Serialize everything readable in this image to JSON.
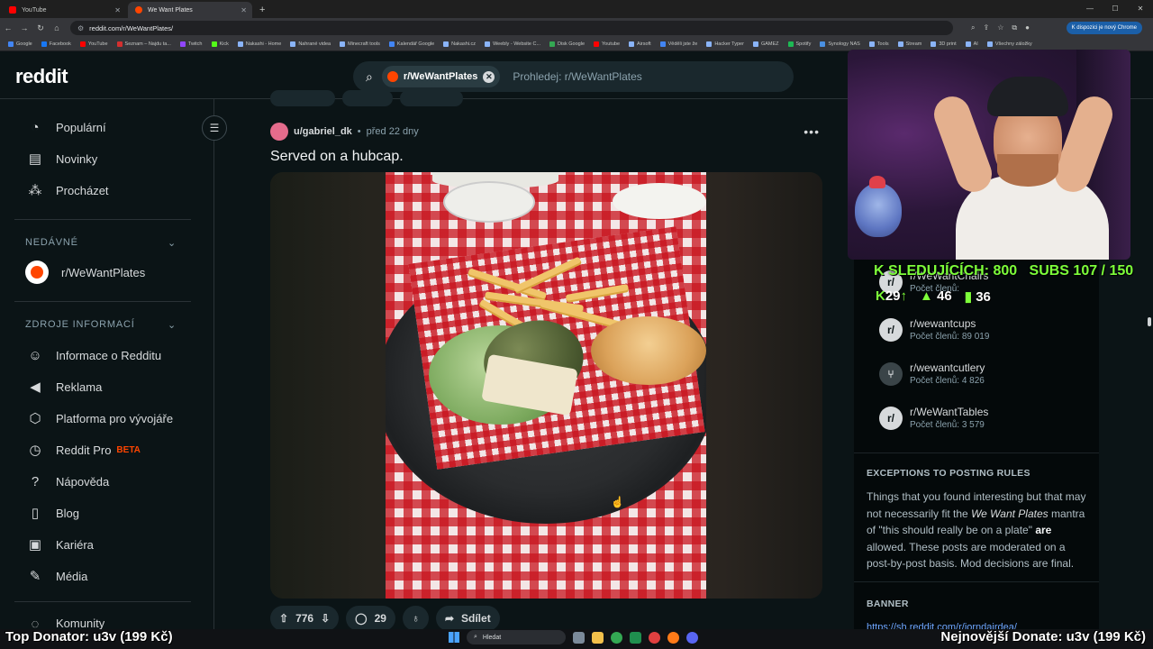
{
  "browser": {
    "tabs": [
      {
        "label": "YouTube",
        "active": false
      },
      {
        "label": "We Want Plates",
        "active": true
      }
    ],
    "new_tab": "+",
    "url": "reddit.com/r/WeWantPlates/",
    "chrome_badge": "K dispozici je nový Chrome",
    "bookmarks": [
      "Google",
      "Facebook",
      "YouTube",
      "Seznam – Najdu ta...",
      "Twitch",
      "Kick",
      "Nakashi - Home",
      "Nahrané videa",
      "Minecraft tools",
      "Kalendář Google",
      "Nakashi.cz",
      "Weebly - Website C...",
      "Disk Google",
      "Youtube",
      "Airsoft",
      "Věděli jste že",
      "Hacker Typer",
      "GAMEZ",
      "Spotify",
      "Synology NAS",
      "Tools",
      "Stream",
      "3D print",
      "AI",
      "Všechny záložky"
    ]
  },
  "reddit": {
    "logo": "reddit",
    "search": {
      "chip_label": "r/WeWantPlates",
      "placeholder": "Prohledej: r/WeWantPlates"
    },
    "nav": {
      "main": [
        {
          "label": "Populární",
          "icon": "trending-icon"
        },
        {
          "label": "Novinky",
          "icon": "news-icon"
        },
        {
          "label": "Procházet",
          "icon": "explore-icon"
        }
      ],
      "recent_title": "NEDÁVNÉ",
      "recent": [
        {
          "label": "r/WeWantPlates"
        }
      ],
      "resources_title": "ZDROJE INFORMACÍ",
      "resources": [
        {
          "label": "Informace o Redditu",
          "icon": "reddit-icon"
        },
        {
          "label": "Reklama",
          "icon": "megaphone-icon"
        },
        {
          "label": "Platforma pro vývojáře",
          "icon": "hexagon-icon"
        },
        {
          "label": "Reddit Pro",
          "icon": "clock-icon",
          "badge": "BETA"
        },
        {
          "label": "Nápověda",
          "icon": "help-icon"
        },
        {
          "label": "Blog",
          "icon": "book-icon"
        },
        {
          "label": "Kariéra",
          "icon": "briefcase-icon"
        },
        {
          "label": "Média",
          "icon": "mic-icon"
        }
      ],
      "communities_cut": "Komunity"
    },
    "post": {
      "author": "u/gabriel_dk",
      "separator": "•",
      "age": "před 22 dny",
      "more": "•••",
      "title": "Served on a hubcap.",
      "votes": "776",
      "comments": "29",
      "share": "Sdílet"
    },
    "sidebar": {
      "related": [
        {
          "name": "r/WeWantChairs",
          "meta": "Počet členů:"
        },
        {
          "name": "r/wewantcups",
          "meta": "Počet členů: 89 019"
        },
        {
          "name": "r/wewantcutlery",
          "meta": "Počet členů: 4 826"
        },
        {
          "name": "r/WeWantTables",
          "meta": "Počet členů: 3 579"
        }
      ],
      "rules_title": "EXCEPTIONS TO POSTING RULES",
      "rules_text_1": "Things that you found interesting but that may not necessarily fit the ",
      "rules_em": "We Want Plates",
      "rules_text_2": " mantra of \"this should really be on a plate\" ",
      "rules_bold": "are",
      "rules_text_3": " allowed. These posts are moderated on a post-by-post basis. Mod decisions are final.",
      "banner_title": "BANNER",
      "banner_link": "https://sh.reddit.com/r/jorndairdea/"
    }
  },
  "overlay": {
    "viewers": "SLEDUJÍCÍCH: 800",
    "subs": "SUBS 107 / 150",
    "kick_count": "29",
    "follow_count": "46",
    "chart_count": "36",
    "top_donator": "Top Donator: u3v (199 Kč)",
    "latest_donate": "Nejnovější Donate: u3v (199 Kč)"
  },
  "taskbar": {
    "search": "Hledat"
  },
  "colors": {
    "accent": "#ff4500",
    "stream_green": "#7dff3a",
    "link": "#6ea6ff"
  }
}
